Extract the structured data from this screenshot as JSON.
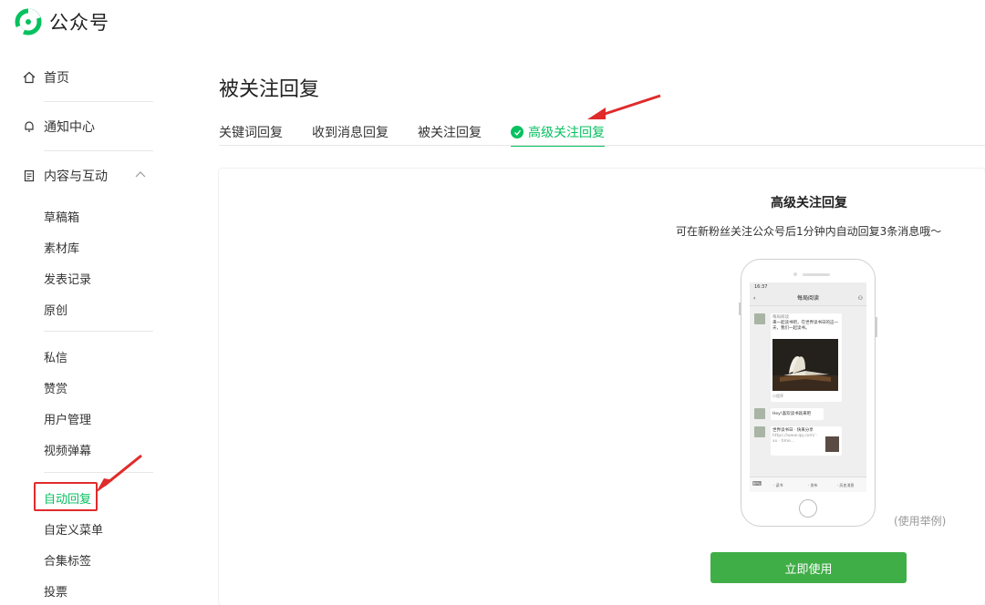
{
  "app": {
    "brand": "公众号"
  },
  "sidebar": {
    "home": "首页",
    "notifications": "通知中心",
    "content_section": "内容与互动",
    "sub_group1": [
      "草稿箱",
      "素材库",
      "发表记录",
      "原创"
    ],
    "sub_group2": [
      "私信",
      "赞赏",
      "用户管理",
      "视频弹幕"
    ],
    "sub_group3": [
      "自动回复",
      "自定义菜单",
      "合集标签",
      "投票"
    ]
  },
  "main": {
    "title": "被关注回复",
    "tabs": [
      "关键词回复",
      "收到消息回复",
      "被关注回复",
      "高级关注回复"
    ],
    "active_tab": "高级关注回复",
    "panel_title": "高级关注回复",
    "panel_desc": "可在新粉丝关注公众号后1分钟内自动回复3条消息哦～",
    "example_note": "(使用举例)",
    "use_button": "立即使用"
  },
  "phone_preview": {
    "time": "16:37",
    "chat_title": "每局阅读",
    "msg1_name": "每局阅读",
    "msg1_text": "来一起读书吧，在世界读书日的这一天，我们一起读书。",
    "msg1_footer": "小程序",
    "msg2_text": "Hey!喜欢读书就来吧",
    "msg3_title": "世界读书日 · 快来分享",
    "msg3_link": "https://www.qq.com/ · xx · time...",
    "bottom_tabs": [
      "· 读书",
      "· 发布",
      "· 历史消息"
    ]
  },
  "colors": {
    "accent": "#07c160",
    "button": "#3fae47",
    "annotation": "#e02b2b"
  }
}
